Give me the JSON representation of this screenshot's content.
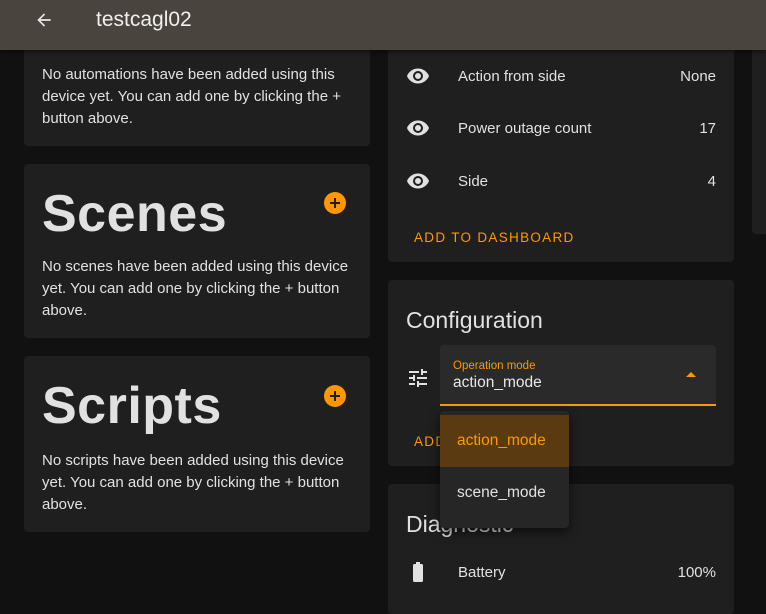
{
  "header": {
    "title": "testcagl02",
    "back_icon": "arrow-left-icon"
  },
  "automations_card": {
    "text": "No automations have been added using this device yet. You can add one by clicking the + button above."
  },
  "scenes_card": {
    "title": "Scenes",
    "text": "No scenes have been added using this device yet. You can add one by clicking the + button above.",
    "add_icon": "plus-circle-icon"
  },
  "scripts_card": {
    "title": "Scripts",
    "text": "No scripts have been added using this device yet. You can add one by clicking the + button above.",
    "add_icon": "plus-circle-icon"
  },
  "sensors_card": {
    "rows": [
      {
        "label": "Action from side",
        "value": "None",
        "icon": "eye-icon"
      },
      {
        "label": "Power outage count",
        "value": "17",
        "icon": "eye-icon"
      },
      {
        "label": "Side",
        "value": "4",
        "icon": "eye-icon"
      }
    ],
    "add_to_dashboard": "ADD TO DASHBOARD"
  },
  "configuration_card": {
    "title": "Configuration",
    "icon": "tune-icon",
    "select": {
      "label": "Operation mode",
      "value": "action_mode"
    },
    "partial_button": "ADD",
    "options": [
      "action_mode",
      "scene_mode"
    ],
    "selected_option": "action_mode"
  },
  "diagnostic_card": {
    "title": "Diagnostic",
    "rows": [
      {
        "label": "Battery",
        "value": "100%",
        "icon": "battery-icon"
      }
    ]
  },
  "colors": {
    "accent": "#ff9800",
    "topbar": "#4a443f",
    "card": "#1f1f1f",
    "background": "#111111"
  }
}
